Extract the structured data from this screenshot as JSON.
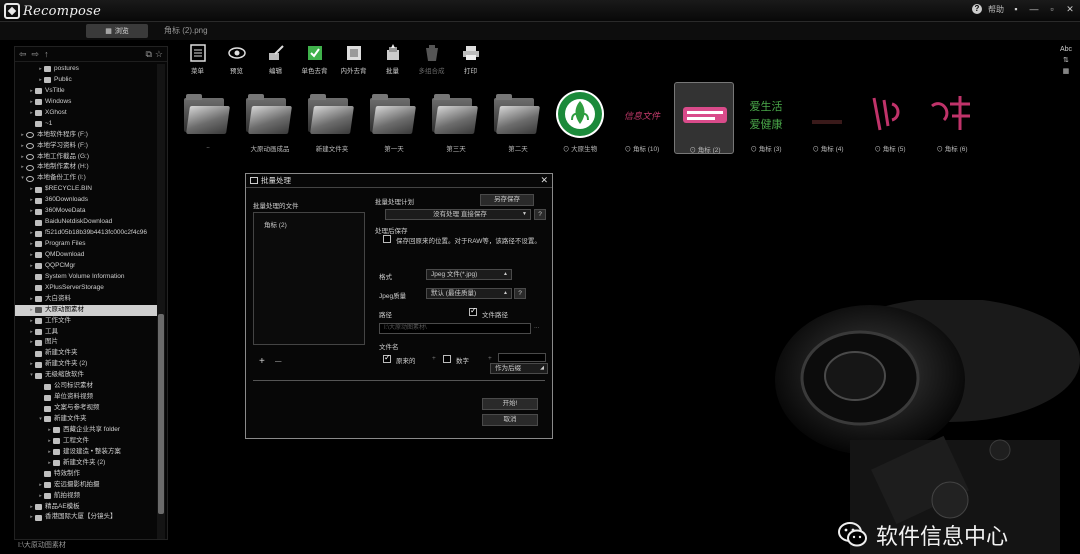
{
  "app": {
    "logo_text": "Recompose",
    "help_label": "帮助"
  },
  "window_controls": [
    "▪",
    "—",
    "▫",
    "✕"
  ],
  "tabs": {
    "browse_label": "浏览",
    "file_tab": "角标 (2).png"
  },
  "sidebar": {
    "tree": [
      {
        "label": "postures",
        "indent": 2,
        "kind": "folder",
        "arrow": "▸"
      },
      {
        "label": "Public",
        "indent": 2,
        "kind": "folder",
        "arrow": "▸"
      },
      {
        "label": "VsTitle",
        "indent": 1,
        "kind": "folder",
        "arrow": "▸"
      },
      {
        "label": "Windows",
        "indent": 1,
        "kind": "folder",
        "arrow": "▸"
      },
      {
        "label": "XGhost",
        "indent": 1,
        "kind": "folder",
        "arrow": "▸"
      },
      {
        "label": "~1",
        "indent": 1,
        "kind": "folder",
        "arrow": ""
      },
      {
        "label": "本地软件程序 (F:)",
        "indent": 0,
        "kind": "drive",
        "arrow": "▸"
      },
      {
        "label": "本地学习资料 (F:)",
        "indent": 0,
        "kind": "drive",
        "arrow": "▸"
      },
      {
        "label": "本地工作截品 (G:)",
        "indent": 0,
        "kind": "drive",
        "arrow": "▸"
      },
      {
        "label": "本地制作素材 (H:)",
        "indent": 0,
        "kind": "drive",
        "arrow": "▸"
      },
      {
        "label": "本地备份工作 (I:)",
        "indent": 0,
        "kind": "drive",
        "arrow": "▾"
      },
      {
        "label": "$RECYCLE.BIN",
        "indent": 1,
        "kind": "folder",
        "arrow": "▸"
      },
      {
        "label": "360Downloads",
        "indent": 1,
        "kind": "folder",
        "arrow": "▸"
      },
      {
        "label": "360MoveData",
        "indent": 1,
        "kind": "folder",
        "arrow": "▸"
      },
      {
        "label": "BaiduNetdiskDownload",
        "indent": 1,
        "kind": "folder",
        "arrow": ""
      },
      {
        "label": "f521d05b18b39b4413fc000c2f4c96",
        "indent": 1,
        "kind": "folder",
        "arrow": "▸"
      },
      {
        "label": "Program Files",
        "indent": 1,
        "kind": "folder",
        "arrow": "▸"
      },
      {
        "label": "QMDownload",
        "indent": 1,
        "kind": "folder",
        "arrow": "▸"
      },
      {
        "label": "QQPCMgr",
        "indent": 1,
        "kind": "folder",
        "arrow": "▸"
      },
      {
        "label": "System Volume Information",
        "indent": 1,
        "kind": "folder",
        "arrow": ""
      },
      {
        "label": "XPlusServerStorage",
        "indent": 1,
        "kind": "folder",
        "arrow": ""
      },
      {
        "label": "大白资料",
        "indent": 1,
        "kind": "folder",
        "arrow": "▸"
      },
      {
        "label": "大原动图素材",
        "indent": 1,
        "kind": "folder",
        "arrow": "▸",
        "selected": true
      },
      {
        "label": "工作文件",
        "indent": 1,
        "kind": "folder",
        "arrow": "▸"
      },
      {
        "label": "工具",
        "indent": 1,
        "kind": "folder",
        "arrow": "▸"
      },
      {
        "label": "图片",
        "indent": 1,
        "kind": "folder",
        "arrow": "▸"
      },
      {
        "label": "新建文件夹",
        "indent": 1,
        "kind": "folder",
        "arrow": ""
      },
      {
        "label": "新建文件夹 (2)",
        "indent": 1,
        "kind": "folder",
        "arrow": "▸"
      },
      {
        "label": "无级缩放软件",
        "indent": 1,
        "kind": "folder",
        "arrow": "▾"
      },
      {
        "label": "公司标识素材",
        "indent": 2,
        "kind": "folder",
        "arrow": ""
      },
      {
        "label": "单位资料视频",
        "indent": 2,
        "kind": "folder",
        "arrow": ""
      },
      {
        "label": "文案与参考视频",
        "indent": 2,
        "kind": "folder",
        "arrow": ""
      },
      {
        "label": "新建文件夹",
        "indent": 2,
        "kind": "folder",
        "arrow": "▾"
      },
      {
        "label": "西藏企业共享 folder",
        "indent": 3,
        "kind": "folder",
        "arrow": "▸"
      },
      {
        "label": "工程文件",
        "indent": 3,
        "kind": "folder",
        "arrow": "▸"
      },
      {
        "label": "建设建造 • 整装方案",
        "indent": 3,
        "kind": "folder",
        "arrow": "▸"
      },
      {
        "label": "新建文件夹 (2)",
        "indent": 3,
        "kind": "folder",
        "arrow": "▸"
      },
      {
        "label": "特效制作",
        "indent": 2,
        "kind": "folder",
        "arrow": ""
      },
      {
        "label": "宏远摄影机拍摄",
        "indent": 2,
        "kind": "folder",
        "arrow": "▸"
      },
      {
        "label": "航拍视频",
        "indent": 2,
        "kind": "folder",
        "arrow": "▸"
      },
      {
        "label": "精品AE模板",
        "indent": 1,
        "kind": "folder",
        "arrow": "▸"
      },
      {
        "label": "香港国际大厦【分镜头】",
        "indent": 1,
        "kind": "folder",
        "arrow": "▸"
      }
    ],
    "status_path": "I:\\大原动图素材"
  },
  "toolbar": {
    "items": [
      {
        "label": "菜单",
        "icon": "menu-icon",
        "dim": false
      },
      {
        "label": "预览",
        "icon": "eye-icon",
        "dim": false
      },
      {
        "label": "编辑",
        "icon": "edit-icon",
        "dim": false
      },
      {
        "label": "单色去背",
        "icon": "mono-remove-bg-icon",
        "dim": false
      },
      {
        "label": "内外去背",
        "icon": "inout-remove-bg-icon",
        "dim": false
      },
      {
        "label": "批量",
        "icon": "batch-icon",
        "dim": false
      },
      {
        "label": "多组合成",
        "icon": "multi-compose-icon",
        "dim": true
      },
      {
        "label": "打印",
        "icon": "printer-icon",
        "dim": false
      }
    ],
    "view_label": "Abc"
  },
  "thumbnails": [
    {
      "caption": "..",
      "kind": "folder"
    },
    {
      "caption": "大原动画成品",
      "kind": "folder"
    },
    {
      "caption": "新建文件夹",
      "kind": "folder"
    },
    {
      "caption": "第一天",
      "kind": "folder"
    },
    {
      "caption": "第三天",
      "kind": "folder"
    },
    {
      "caption": "第二天",
      "kind": "folder"
    },
    {
      "caption": "⊙ 大原生物",
      "kind": "logo"
    },
    {
      "caption": "⊙ 角标 (10)",
      "kind": "text-art",
      "art": "信息文件"
    },
    {
      "caption": "⊙ 角标 (2)",
      "kind": "badge",
      "selected": true
    },
    {
      "caption": "⊙ 角标 (3)",
      "kind": "health",
      "art1": "爱生活",
      "art2": "爱健康"
    },
    {
      "caption": "⊙ 角标 (4)",
      "kind": "dark"
    },
    {
      "caption": "⊙ 角标 (5)",
      "kind": "pink-art"
    },
    {
      "caption": "⊙ 角标 (6)",
      "kind": "pink-art2"
    }
  ],
  "batch_dialog": {
    "title": "批量处理",
    "files_label": "批量处理的文件",
    "file_item": "角标 (2)",
    "add": "+",
    "remove": "—",
    "plan_label": "批量处理计划",
    "save_plan_button": "另存保存",
    "plan_value": "没有处理 直接保存",
    "save_section": "处理后保存",
    "save_original_checkbox": "保存回原来的位置。对于RAW等，该路径不设置。",
    "format_label": "格式",
    "format_value": "Jpeg 文件(*.jpg)",
    "quality_label": "Jpeg质量",
    "quality_value": "默认 (最佳质量)",
    "help_button": "?",
    "path_label": "路径",
    "file_path_checkbox": "文件路径",
    "path_placeholder": "I:\\大原动图素材\\",
    "filename_label": "文件名",
    "original_name_checkbox": "原来的",
    "number_checkbox": "数字",
    "suffix_button": "作为后缀",
    "start_button": "开始!",
    "cancel_button": "取消"
  },
  "watermark": {
    "text": "软件信息中心"
  }
}
